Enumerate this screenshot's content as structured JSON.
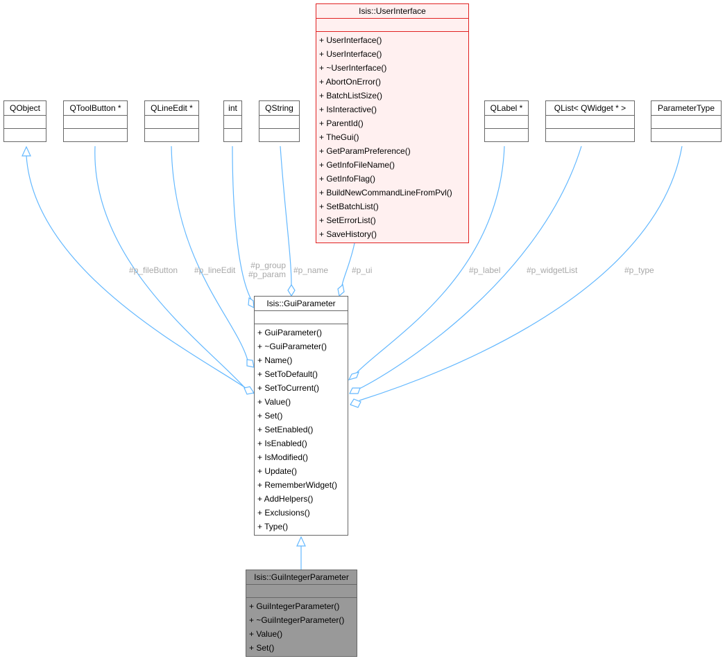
{
  "nodes": {
    "qobject": {
      "title": "QObject"
    },
    "qtoolbutton": {
      "title": "QToolButton *"
    },
    "qlineedit": {
      "title": "QLineEdit *"
    },
    "int": {
      "title": "int"
    },
    "qstring": {
      "title": "QString"
    },
    "qlabel": {
      "title": "QLabel *"
    },
    "qlist": {
      "title": "QList< QWidget * >"
    },
    "parametertype": {
      "title": "ParameterType"
    },
    "userinterface": {
      "title": "Isis::UserInterface",
      "operations": [
        "+ UserInterface()",
        "+ UserInterface()",
        "+ ~UserInterface()",
        "+ AbortOnError()",
        "+ BatchListSize()",
        "+ IsInteractive()",
        "+ ParentId()",
        "+ TheGui()",
        "+ GetParamPreference()",
        "+ GetInfoFileName()",
        "+ GetInfoFlag()",
        "+ BuildNewCommandLineFromPvl()",
        "+ SetBatchList()",
        "+ SetErrorList()",
        "+ SaveHistory()"
      ]
    },
    "guiparameter": {
      "title": "Isis::GuiParameter",
      "operations": [
        "+ GuiParameter()",
        "+ ~GuiParameter()",
        "+ Name()",
        "+ SetToDefault()",
        "+ SetToCurrent()",
        "+ Value()",
        "+ Set()",
        "+ SetEnabled()",
        "+ IsEnabled()",
        "+ IsModified()",
        "+ Update()",
        "+ RememberWidget()",
        "+ AddHelpers()",
        "+ Exclusions()",
        "+ Type()"
      ]
    },
    "guiintegerparameter": {
      "title": "Isis::GuiIntegerParameter",
      "operations": [
        "+ GuiIntegerParameter()",
        "+ ~GuiIntegerParameter()",
        "+ Value()",
        "+ Set()"
      ]
    }
  },
  "edge_labels": {
    "file_button": "#p_fileButton",
    "line_edit": "#p_lineEdit",
    "group": "#p_group",
    "param": "#p_param",
    "name": "#p_name",
    "ui": "#p_ui",
    "label": "#p_label",
    "widget_list": "#p_widgetList",
    "type": "#p_type"
  },
  "colors": {
    "edge": "#63b8ff",
    "highlight_border": "#e02020",
    "highlight_fill": "#fff0f0",
    "current_fill": "#999999",
    "label_text": "#a8a8a8"
  }
}
